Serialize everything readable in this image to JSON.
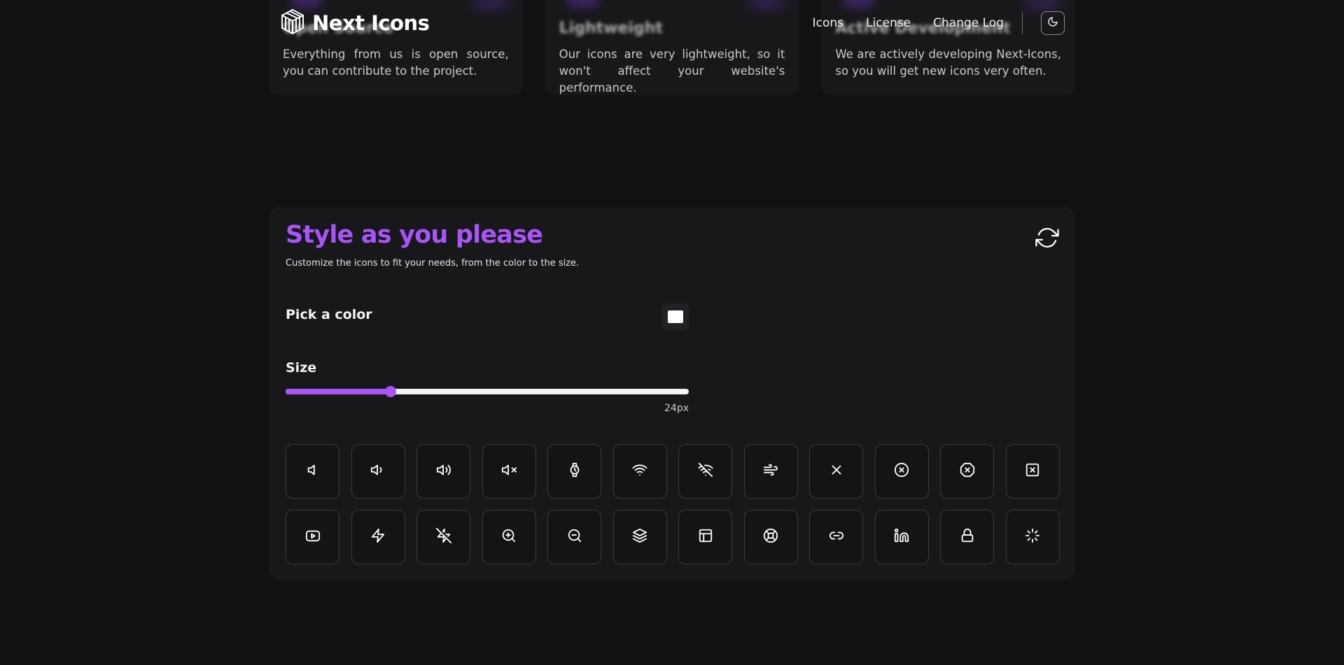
{
  "header": {
    "logo_text": "Next Icons",
    "nav": {
      "icons": "Icons",
      "license": "License",
      "changelog": "Change Log"
    }
  },
  "features": [
    {
      "title": "Open Source",
      "desc": "Everything from us is open source, you can contribute to the project."
    },
    {
      "title": "Lightweight",
      "desc": "Our icons are very lightweight, so it won't affect your website's performance."
    },
    {
      "title": "Active Development",
      "desc": "We are actively developing Next-Icons, so you will get new icons very often."
    }
  ],
  "customizer": {
    "title": "Style as you please",
    "subtitle": "Customize the icons to fit your needs, from the color to the size.",
    "color_label": "Pick a color",
    "color_value": "#ffffff",
    "size_label": "Size",
    "size_value": "24px",
    "size_fraction": 0.26
  },
  "icons": [
    "volume-icon",
    "volume-1-icon",
    "volume-2-icon",
    "volume-x-icon",
    "watch-icon",
    "wifi-icon",
    "wifi-off-icon",
    "wind-icon",
    "x-icon",
    "x-circle-icon",
    "x-octagon-icon",
    "x-square-icon",
    "youtube-icon",
    "zap-icon",
    "zap-off-icon",
    "zoom-in-icon",
    "zoom-out-icon",
    "layers-icon",
    "layout-icon",
    "life-buoy-icon",
    "link-icon",
    "linkedin-icon",
    "lock-icon",
    "loader-icon"
  ],
  "colors": {
    "accent": "#a855f7",
    "background": "#111113",
    "panel": "#18181b"
  }
}
